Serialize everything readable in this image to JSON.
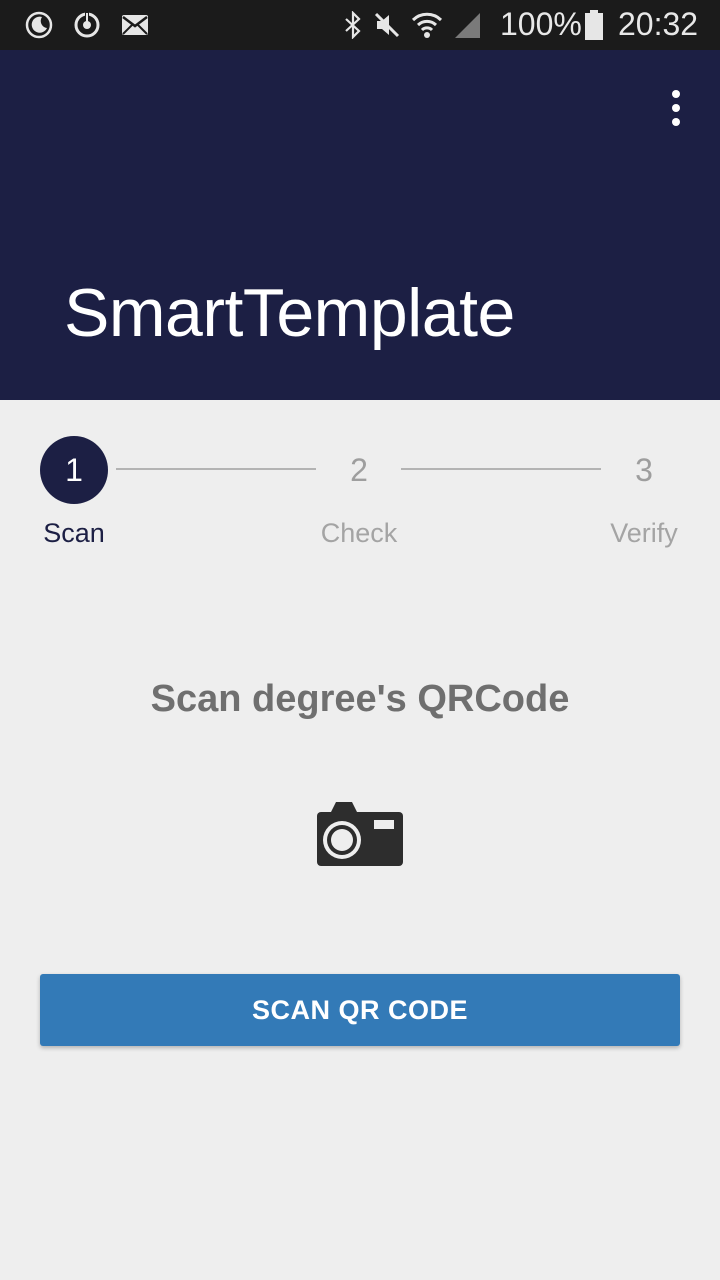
{
  "status_bar": {
    "icons_left": [
      "moon-icon",
      "sync-icon",
      "mail-icon"
    ],
    "icons_right": [
      "bluetooth-icon",
      "mute-icon",
      "wifi-icon",
      "signal-icon",
      "battery-icon"
    ],
    "battery": "100%",
    "time": "20:32"
  },
  "app_bar": {
    "title": "SmartTemplate",
    "menu_icon": "more-vert-icon"
  },
  "stepper": {
    "steps": [
      {
        "number": "1",
        "label": "Scan",
        "state": "active"
      },
      {
        "number": "2",
        "label": "Check",
        "state": "inactive"
      },
      {
        "number": "3",
        "label": "Verify",
        "state": "inactive"
      }
    ]
  },
  "main": {
    "heading": "Scan degree's QRCode",
    "icon": "camera-icon",
    "button_label": "SCAN QR CODE"
  },
  "colors": {
    "app_bar": "#1c1f44",
    "accent": "#337ab7",
    "background": "#eeeeee"
  }
}
